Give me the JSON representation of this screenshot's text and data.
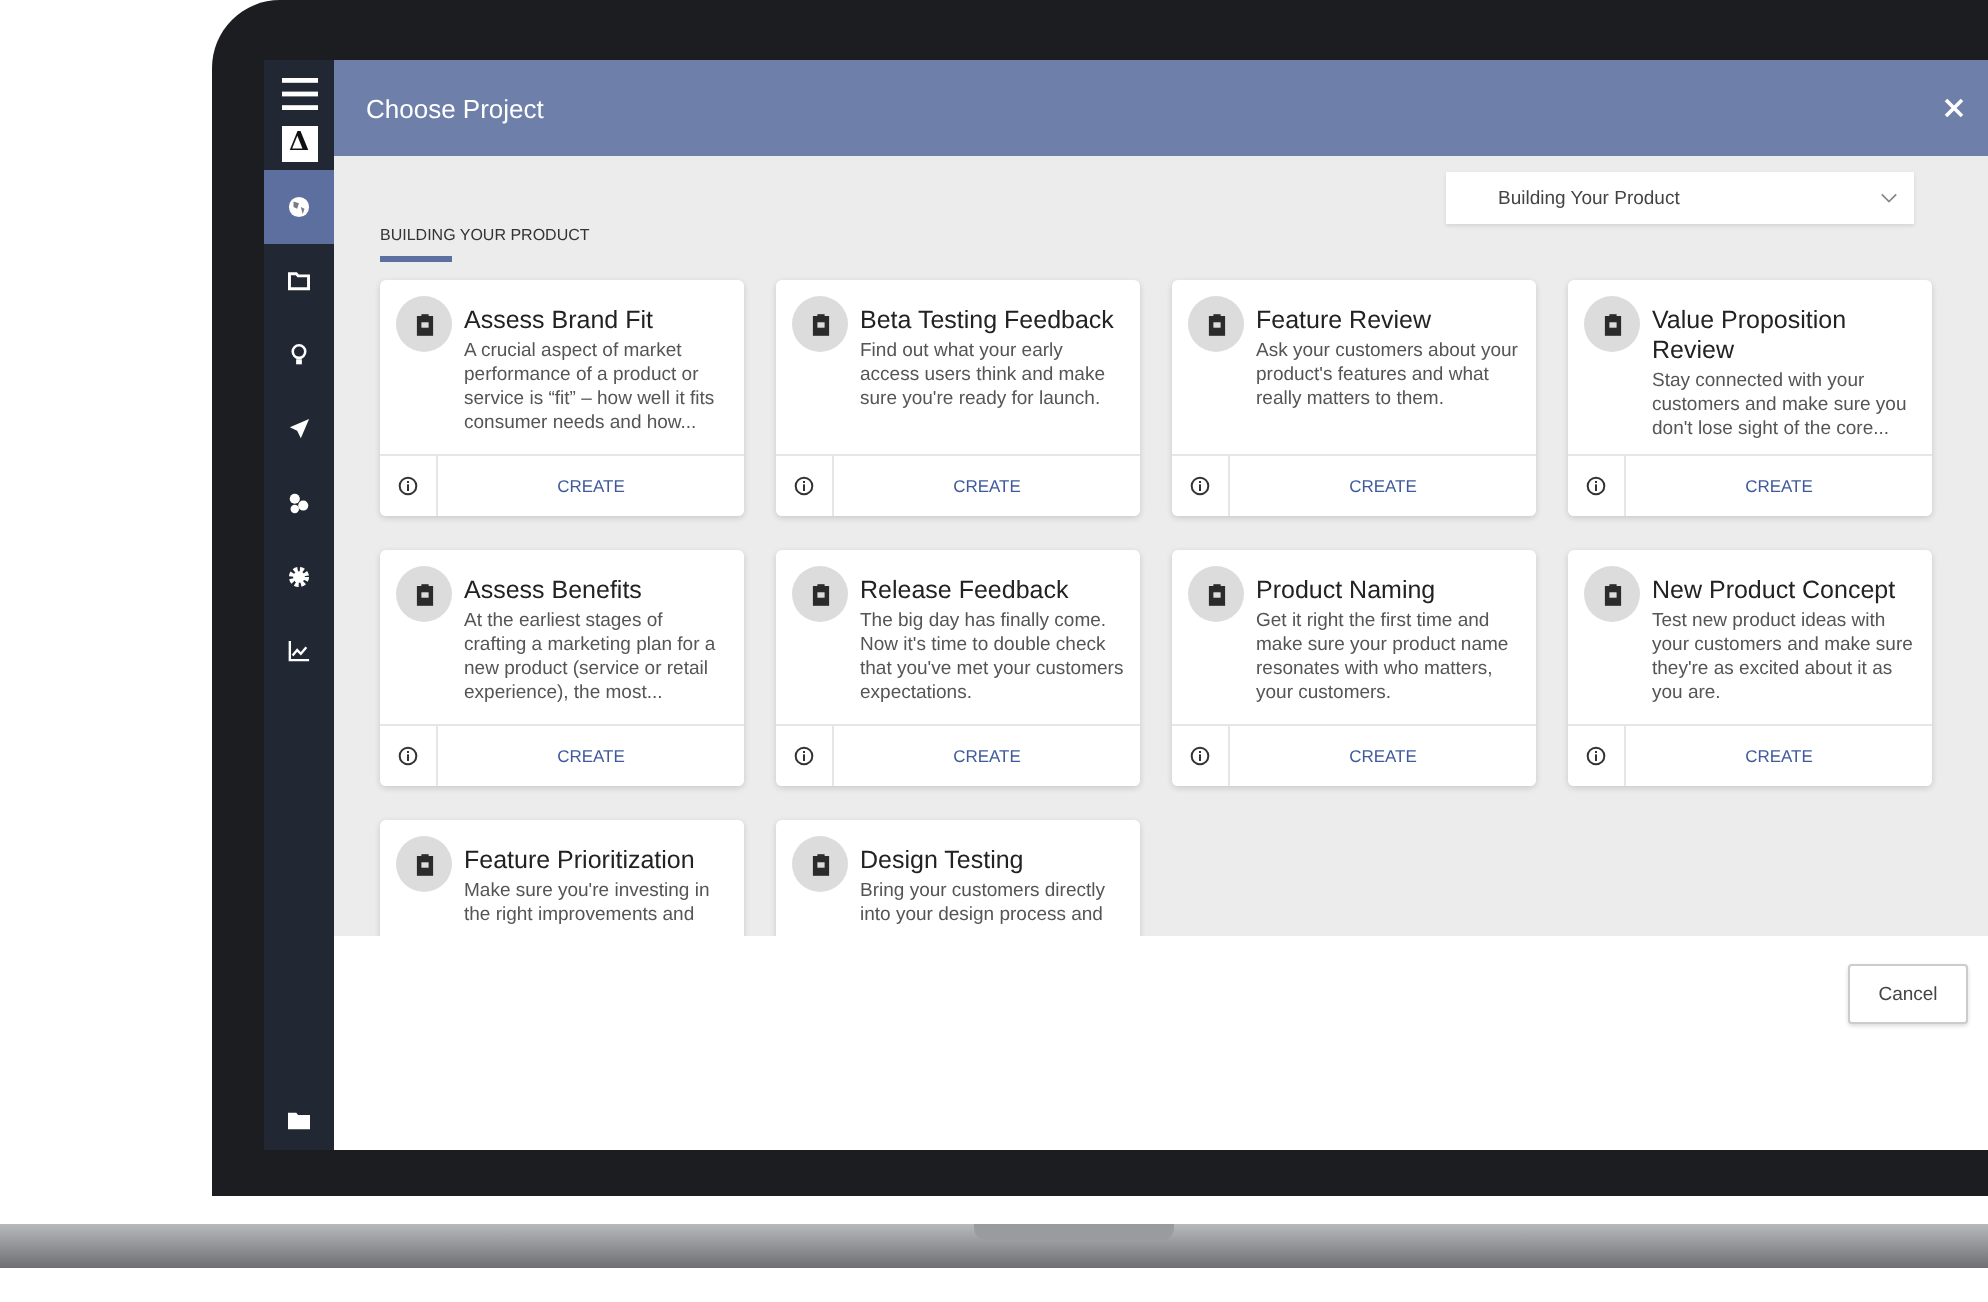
{
  "window": {
    "title": "Choose Project"
  },
  "sidebar": {
    "logo": "Δ",
    "items": [
      {
        "selected": true
      },
      {
        "selected": false
      },
      {
        "selected": false
      },
      {
        "selected": false
      },
      {
        "selected": false
      },
      {
        "selected": false
      },
      {
        "selected": false
      }
    ]
  },
  "filter": {
    "value": "Building Your Product"
  },
  "section": {
    "heading": "BUILDING YOUR PRODUCT"
  },
  "cards": [
    {
      "title": "Assess Brand Fit",
      "description": "A crucial aspect of market performance of a product or service is “fit” – how well it fits consumer needs and how...",
      "action": "CREATE"
    },
    {
      "title": "Beta Testing Feedback",
      "description": "Find out what your early access users think and make sure you're ready for launch.",
      "action": "CREATE"
    },
    {
      "title": "Feature Review",
      "description": "Ask your customers about your product's features and what really matters to them.",
      "action": "CREATE"
    },
    {
      "title": "Value Proposition Review",
      "description": "Stay connected with your customers and make sure you don't lose sight of the core...",
      "action": "CREATE"
    },
    {
      "title": "Assess Benefits",
      "description": "At the earliest stages of crafting a marketing plan for a new product (service or retail experience), the most...",
      "action": "CREATE"
    },
    {
      "title": "Release Feedback",
      "description": "The big day has finally come. Now it's time to double check that you've met your customers expectations.",
      "action": "CREATE"
    },
    {
      "title": "Product Naming",
      "description": "Get it right the first time and make sure your product name resonates with who matters, your customers.",
      "action": "CREATE"
    },
    {
      "title": "New Product Concept",
      "description": "Test new product ideas with your customers and make sure they're as excited about it as you are.",
      "action": "CREATE"
    },
    {
      "title": "Feature Prioritization",
      "description": "Make sure you're investing in the right improvements and"
    },
    {
      "title": "Design Testing",
      "description": "Bring your customers directly into your design process and"
    }
  ],
  "footer": {
    "button": "Cancel"
  }
}
